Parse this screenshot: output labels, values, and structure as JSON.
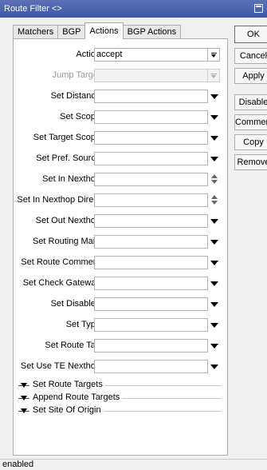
{
  "window": {
    "title": "Route Filter <>"
  },
  "tabs": [
    {
      "label": "Matchers",
      "active": false
    },
    {
      "label": "BGP",
      "active": false
    },
    {
      "label": "Actions",
      "active": true
    },
    {
      "label": "BGP Actions",
      "active": false
    }
  ],
  "form": {
    "action": {
      "label": "Action:",
      "value": "accept"
    },
    "jump_target": {
      "label": "Jump Target:",
      "value": ""
    },
    "set_distance": {
      "label": "Set Distance:",
      "value": ""
    },
    "set_scope": {
      "label": "Set Scope:",
      "value": ""
    },
    "set_target_scope": {
      "label": "Set Target Scope:",
      "value": ""
    },
    "set_pref_source": {
      "label": "Set Pref. Source:",
      "value": ""
    },
    "set_in_nexthop": {
      "label": "Set In Nexthop:",
      "value": ""
    },
    "set_in_nexthop_direct": {
      "label": "Set In Nexthop Direct:",
      "value": ""
    },
    "set_out_nexthop": {
      "label": "Set Out Nexthop:",
      "value": ""
    },
    "set_routing_mark": {
      "label": "Set Routing Mark:",
      "value": ""
    },
    "set_route_comment": {
      "label": "Set Route Comment:",
      "value": ""
    },
    "set_check_gateway": {
      "label": "Set Check Gateway:",
      "value": ""
    },
    "set_disabled": {
      "label": "Set Disabled:",
      "value": ""
    },
    "set_type": {
      "label": "Set Type:",
      "value": ""
    },
    "set_route_tag": {
      "label": "Set Route Tag:",
      "value": ""
    },
    "set_use_te_nexthop": {
      "label": "Set Use TE Nexthop:",
      "value": ""
    }
  },
  "groups": [
    {
      "label": "Set Route Targets"
    },
    {
      "label": "Append Route Targets"
    },
    {
      "label": "Set Site Of Origin"
    }
  ],
  "buttons": {
    "ok": "OK",
    "cancel": "Cancel",
    "apply": "Apply",
    "disable": "Disable",
    "comment": "Comment",
    "copy": "Copy",
    "remove": "Remove"
  },
  "status": {
    "text": "enabled"
  }
}
